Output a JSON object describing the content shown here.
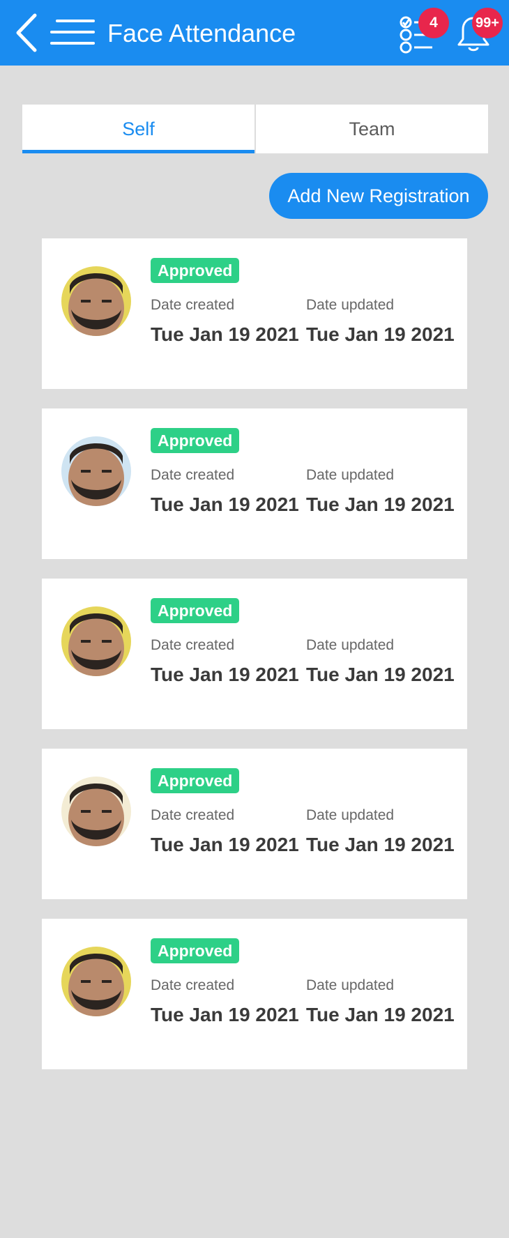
{
  "header": {
    "title": "Face Attendance",
    "tasks_badge": "4",
    "notifications_badge": "99+",
    "bg_color": "#1a8cf0"
  },
  "tabs": [
    {
      "label": "Self",
      "active": true
    },
    {
      "label": "Team",
      "active": false
    }
  ],
  "add_button_label": "Add New Registration",
  "registrations": [
    {
      "status": "Approved",
      "created_label": "Date created",
      "created": "Tue Jan 19 2021",
      "updated_label": "Date updated",
      "updated": "Tue Jan 19 2021"
    },
    {
      "status": "Approved",
      "created_label": "Date created",
      "created": "Tue Jan 19 2021",
      "updated_label": "Date updated",
      "updated": "Tue Jan 19 2021"
    },
    {
      "status": "Approved",
      "created_label": "Date created",
      "created": "Tue Jan 19 2021",
      "updated_label": "Date updated",
      "updated": "Tue Jan 19 2021"
    },
    {
      "status": "Approved",
      "created_label": "Date created",
      "created": "Tue Jan 19 2021",
      "updated_label": "Date updated",
      "updated": "Tue Jan 19 2021"
    },
    {
      "status": "Approved",
      "created_label": "Date created",
      "created": "Tue Jan 19 2021",
      "updated_label": "Date updated",
      "updated": "Tue Jan 19 2021"
    }
  ],
  "colors": {
    "accent": "#1a8cf0",
    "approved": "#2dd087",
    "badge": "#e8264c",
    "background": "#dddddd"
  }
}
